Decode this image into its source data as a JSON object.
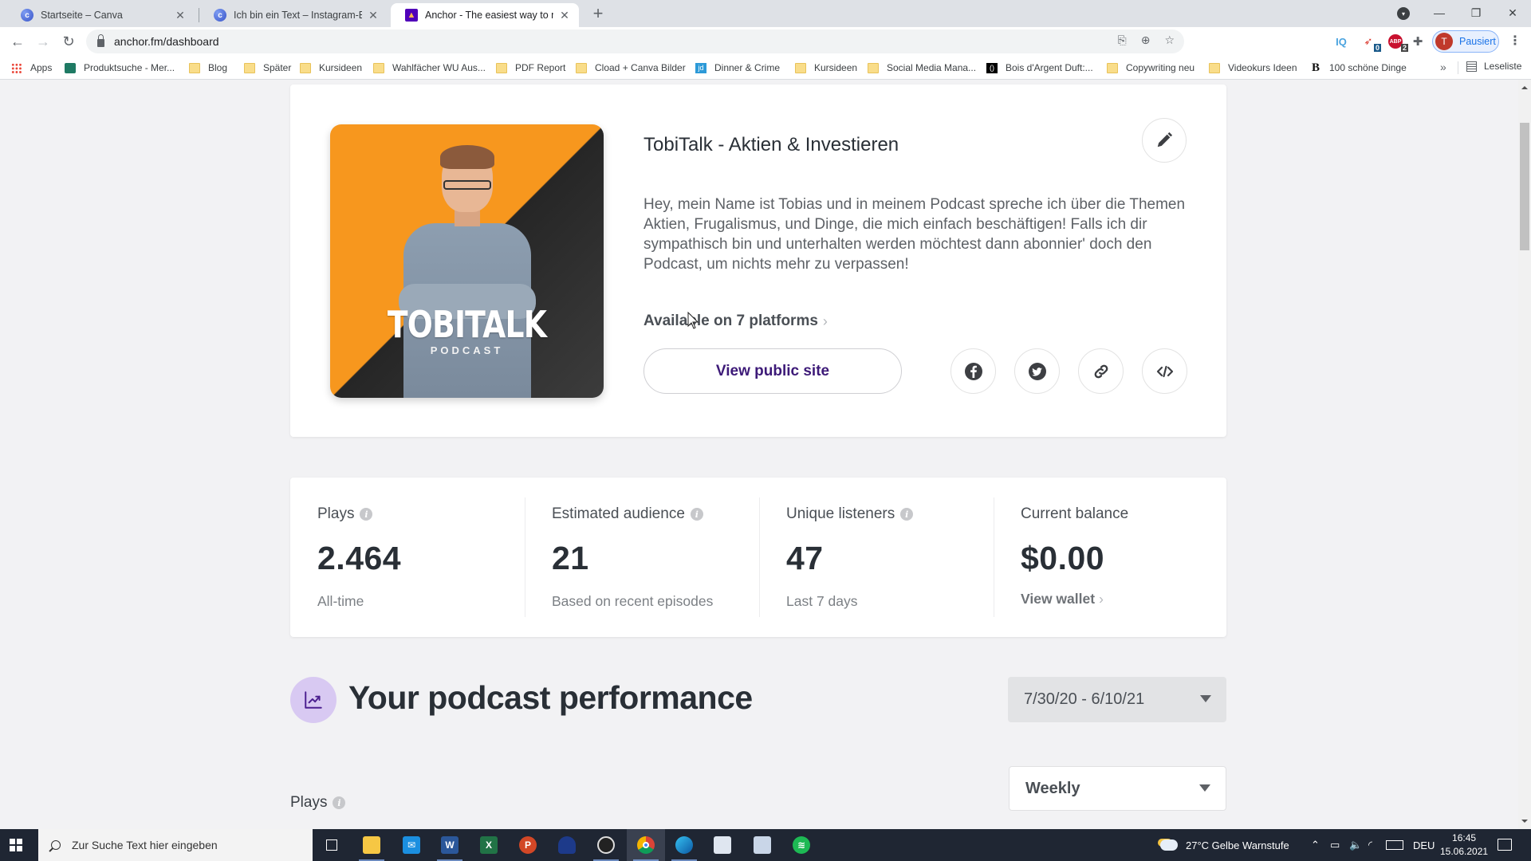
{
  "browser": {
    "tabs": [
      {
        "title": "Startseite – Canva",
        "favicon": "canva-icon",
        "active": false
      },
      {
        "title": "Ich bin ein Text – Instagram-Beitr",
        "favicon": "canva-icon",
        "active": false
      },
      {
        "title": "Anchor - The easiest way to mak",
        "favicon": "anchor-icon",
        "active": true
      }
    ],
    "new_tab_label": "+",
    "url": "anchor.fm/dashboard",
    "profile_initial": "T",
    "profile_status": "Pausiert",
    "extensions": [
      {
        "name": "iq-extension-icon",
        "label": "IQ"
      },
      {
        "name": "bird-extension-icon",
        "badge": "0"
      },
      {
        "name": "adblock-extension-icon",
        "label": "ABP",
        "badge": "2"
      },
      {
        "name": "puzzle-extensions-icon"
      }
    ],
    "bookmarks": [
      {
        "label": "Apps",
        "icon": "apps-grid-icon"
      },
      {
        "label": "Produktsuche - Mer...",
        "icon": "shirt-icon"
      },
      {
        "label": "Blog",
        "icon": "folder-icon"
      },
      {
        "label": "Später",
        "icon": "folder-icon"
      },
      {
        "label": "Kursideen",
        "icon": "folder-icon"
      },
      {
        "label": "Wahlfächer WU Aus...",
        "icon": "folder-icon"
      },
      {
        "label": "PDF Report",
        "icon": "folder-icon"
      },
      {
        "label": "Cload + Canva Bilder",
        "icon": "folder-icon"
      },
      {
        "label": "Dinner & Crime",
        "icon": "jd-icon"
      },
      {
        "label": "Kursideen",
        "icon": "folder-icon"
      },
      {
        "label": "Social Media Mana...",
        "icon": "folder-icon"
      },
      {
        "label": "Bois d'Argent Duft:...",
        "icon": "bois-icon"
      },
      {
        "label": "Copywriting neu",
        "icon": "folder-icon"
      },
      {
        "label": "Videokurs Ideen",
        "icon": "folder-icon"
      },
      {
        "label": "100 schöne Dinge",
        "icon": "b-icon"
      }
    ],
    "bookmarks_more": "»",
    "reading_list": "Leseliste"
  },
  "podcast": {
    "cover_title": "TOBITALK",
    "cover_subtitle": "PODCAST",
    "title": "TobiTalk - Aktien & Investieren",
    "description": "Hey, mein Name ist Tobias und in meinem Podcast spreche ich über die Themen Aktien, Frugalismus, und Dinge, die mich einfach beschäftigen! Falls ich dir sympathisch bin und unterhalten werden möchtest dann abonnier' doch den Podcast, um nichts mehr zu verpassen!",
    "platforms_link": "Available on 7 platforms",
    "view_public_site": "View public site",
    "share_buttons": [
      "facebook",
      "twitter",
      "link",
      "embed"
    ]
  },
  "stats": [
    {
      "label": "Plays",
      "info": true,
      "value": "2.464",
      "sub": "All-time"
    },
    {
      "label": "Estimated audience",
      "info": true,
      "value": "21",
      "sub": "Based on recent episodes"
    },
    {
      "label": "Unique listeners",
      "info": true,
      "value": "47",
      "sub": "Last 7 days"
    },
    {
      "label": "Current balance",
      "info": false,
      "value": "$0.00",
      "link": "View wallet"
    }
  ],
  "performance": {
    "title": "Your podcast performance",
    "date_range": "7/30/20 - 6/10/21",
    "interval": "Weekly",
    "plays_label": "Plays"
  },
  "taskbar": {
    "search_placeholder": "Zur Suche Text hier eingeben",
    "weather": "27°C  Gelbe Warnstufe",
    "language": "DEU",
    "time": "16:45",
    "date": "15.06.2021"
  },
  "colors": {
    "accent_purple": "#3d1a78",
    "cover_orange": "#f7971e",
    "performance_icon_bg": "#d8c9f2"
  }
}
